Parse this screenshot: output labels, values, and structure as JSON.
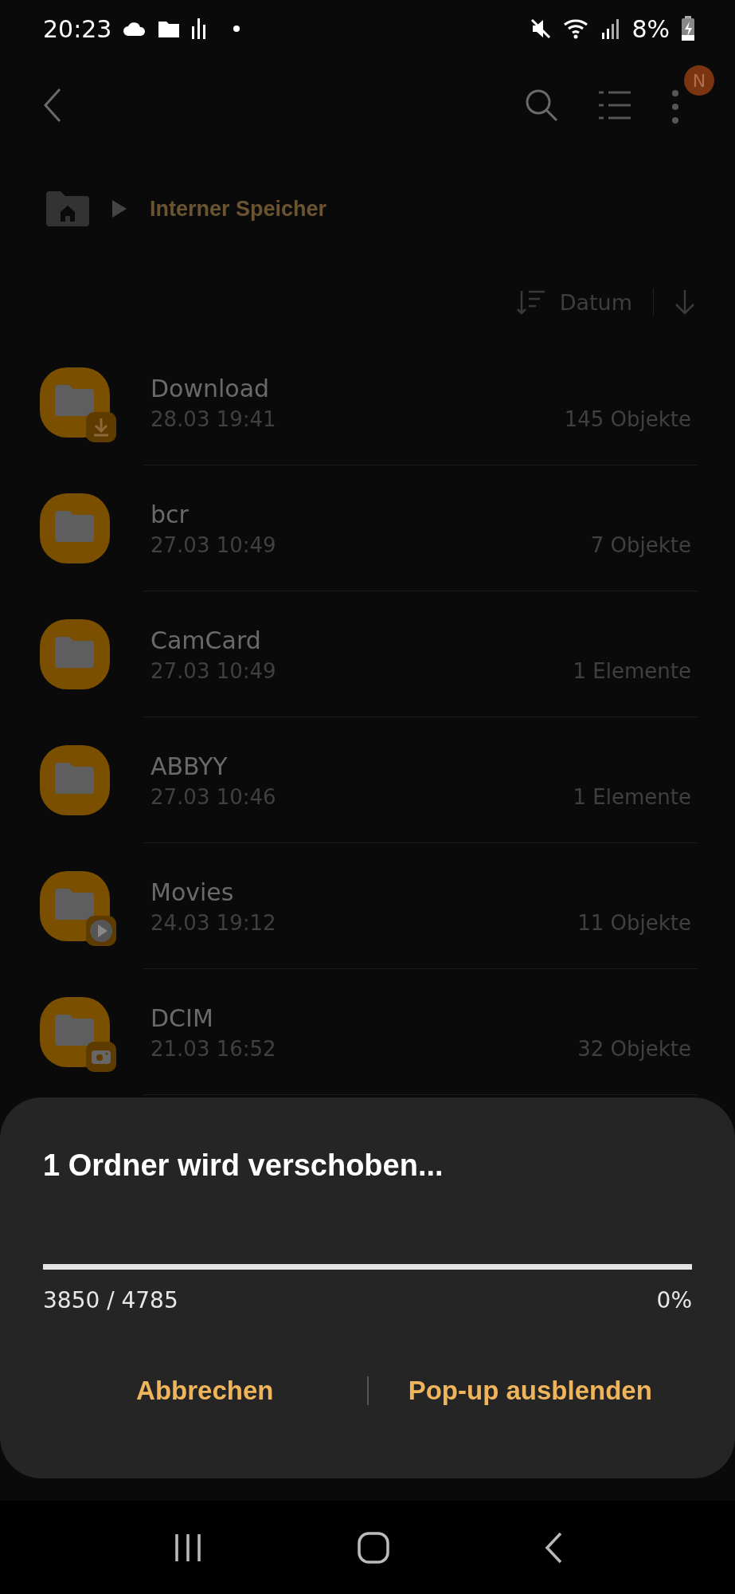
{
  "status_bar": {
    "time": "20:23",
    "battery": "8%"
  },
  "toolbar": {
    "avatar_badge": "N"
  },
  "breadcrumb": {
    "path": "Interner Speicher"
  },
  "sort": {
    "label": "Datum"
  },
  "folders": [
    {
      "name": "Download",
      "date": "28.03 19:41",
      "count": "145 Objekte",
      "kind": "download"
    },
    {
      "name": "bcr",
      "date": "27.03 10:49",
      "count": "7 Objekte",
      "kind": "plain"
    },
    {
      "name": "CamCard",
      "date": "27.03 10:49",
      "count": "1 Elemente",
      "kind": "plain"
    },
    {
      "name": "ABBYY",
      "date": "27.03 10:46",
      "count": "1 Elemente",
      "kind": "plain"
    },
    {
      "name": "Movies",
      "date": "24.03 19:12",
      "count": "11 Objekte",
      "kind": "video"
    },
    {
      "name": "DCIM",
      "date": "21.03 16:52",
      "count": "32 Objekte",
      "kind": "camera"
    }
  ],
  "dialog": {
    "title": "1 Ordner wird verschoben...",
    "progress": {
      "level": 0,
      "count": "3850 / 4785",
      "percent": "0%"
    },
    "buttons": [
      "Abbrechen",
      "Pop-up ausblenden"
    ]
  }
}
